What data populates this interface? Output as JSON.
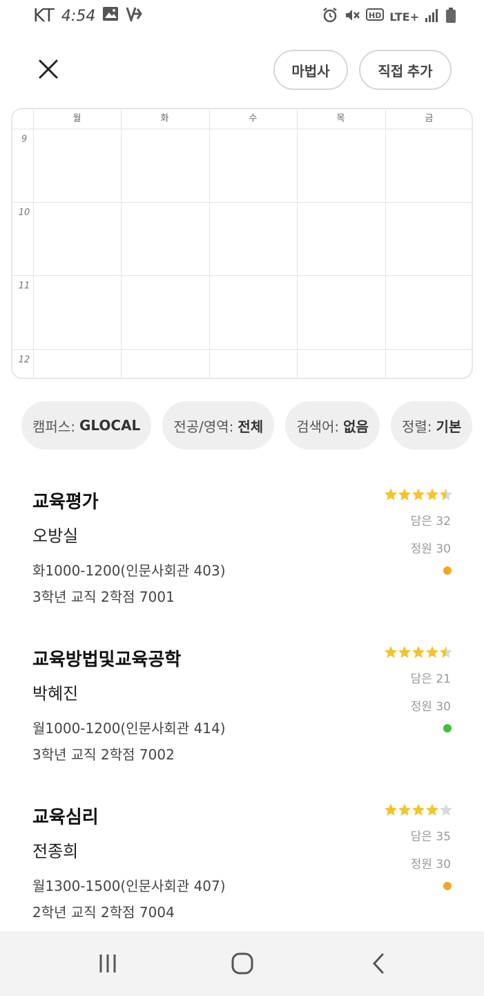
{
  "status_bar": {
    "carrier": "KT",
    "time": "4:54",
    "network": "LTE+"
  },
  "header": {
    "wizard_label": "마법사",
    "direct_add_label": "직접 추가"
  },
  "timetable": {
    "days": [
      "월",
      "화",
      "수",
      "목",
      "금"
    ],
    "hours": [
      "9",
      "10",
      "11",
      "12"
    ]
  },
  "filters": [
    {
      "label": "캠퍼스:",
      "value": "GLOCAL"
    },
    {
      "label": "전공/영역:",
      "value": "전체"
    },
    {
      "label": "검색어:",
      "value": "없음"
    },
    {
      "label": "정렬:",
      "value": "기본"
    }
  ],
  "courses": [
    {
      "title": "교육평가",
      "professor": "오방실",
      "schedule": "화1000-1200(인문사회관 403)",
      "meta": "3학년 교직 2학점 7001",
      "rating": 4.5,
      "enrolled": "담은 32",
      "capacity": "정원 30",
      "status_color": "#f5a623"
    },
    {
      "title": "교육방법및교육공학",
      "professor": "박혜진",
      "schedule": "월1000-1200(인문사회관 414)",
      "meta": "3학년 교직 2학점 7002",
      "rating": 4.5,
      "enrolled": "담은 21",
      "capacity": "정원 30",
      "status_color": "#3cc13b"
    },
    {
      "title": "교육심리",
      "professor": "전종희",
      "schedule": "월1300-1500(인문사회관 407)",
      "meta": "2학년 교직 2학점 7004",
      "rating": 4,
      "enrolled": "담은 35",
      "capacity": "정원 30",
      "status_color": "#f5a623"
    }
  ],
  "colors": {
    "star_filled": "#f7c325",
    "star_empty": "#d9d9d9"
  },
  "icons": {
    "close": "close-icon",
    "recents": "recent-apps-icon",
    "home": "home-icon",
    "back": "back-icon"
  }
}
